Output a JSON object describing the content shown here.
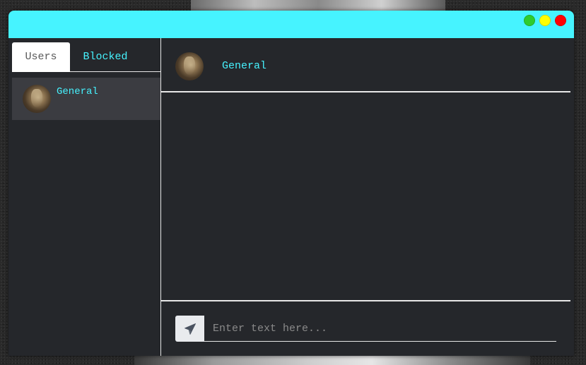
{
  "window": {
    "controls": [
      "minimize",
      "maximize",
      "close"
    ],
    "colors": {
      "titlebar": "#46f3ff",
      "green": "#2ecc2e",
      "yellow": "#ffff00",
      "red": "#ff0000"
    }
  },
  "sidebar": {
    "tabs": [
      {
        "label": "Users",
        "active": true
      },
      {
        "label": "Blocked",
        "active": false
      }
    ],
    "users": [
      {
        "name": "General",
        "avatar": "cat-avatar"
      }
    ]
  },
  "chat": {
    "title": "General",
    "avatar": "cat-avatar",
    "composer": {
      "placeholder": "Enter text here...",
      "value": "",
      "send_icon": "paper-plane-icon"
    }
  },
  "accent": "#46f3ff",
  "panel": "#25272b"
}
